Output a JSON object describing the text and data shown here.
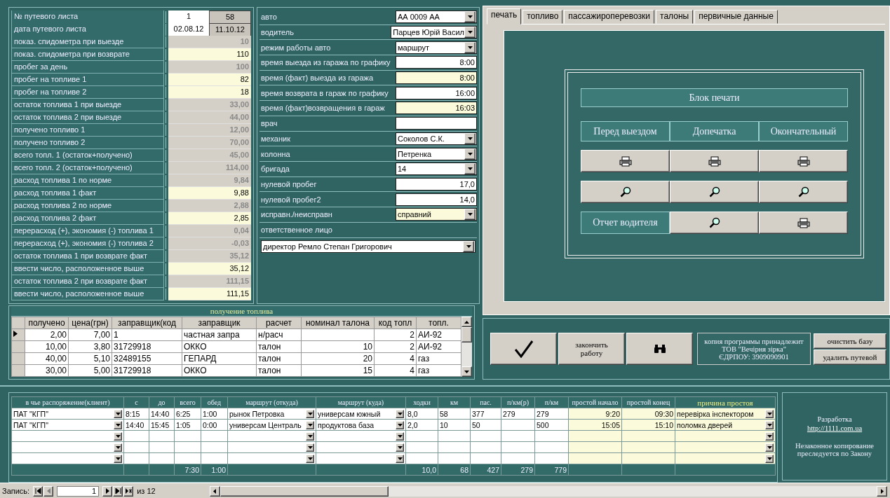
{
  "trip_sheet_fields": [
    {
      "label": "№ путевого листа",
      "values": [
        {
          "text": "1",
          "kind": "plain"
        },
        {
          "text": "58",
          "kind": "locked"
        }
      ]
    },
    {
      "label": "дата путевого листа",
      "values": [
        {
          "text": "02.08.12",
          "kind": "plain"
        },
        {
          "text": "11.10.12",
          "kind": "locked"
        }
      ]
    },
    {
      "label": "показ. спидометра при выезде",
      "values": [
        {
          "text": "10",
          "kind": "computed"
        }
      ]
    },
    {
      "label": "показ. спидометра при возврате",
      "values": [
        {
          "text": "110",
          "kind": "input"
        }
      ]
    },
    {
      "label": "пробег за день",
      "values": [
        {
          "text": "100",
          "kind": "computed"
        }
      ]
    },
    {
      "label": "пробег на топливе 1",
      "values": [
        {
          "text": "82",
          "kind": "input"
        }
      ]
    },
    {
      "label": "пробег на топливе 2",
      "values": [
        {
          "text": "18",
          "kind": "input"
        }
      ]
    },
    {
      "label": "остаток  топлива 1 при выезде",
      "values": [
        {
          "text": "33,00",
          "kind": "computed"
        }
      ]
    },
    {
      "label": "остаток топлива 2 при выезде",
      "values": [
        {
          "text": "44,00",
          "kind": "computed"
        }
      ]
    },
    {
      "label": "получено топливо 1",
      "values": [
        {
          "text": "12,00",
          "kind": "computed"
        }
      ]
    },
    {
      "label": "получено топливо 2",
      "values": [
        {
          "text": "70,00",
          "kind": "computed"
        }
      ]
    },
    {
      "label": "всего топл. 1 (остаток+получено)",
      "values": [
        {
          "text": "45,00",
          "kind": "computed"
        }
      ]
    },
    {
      "label": "всего топл. 2 (остаток+получено)",
      "values": [
        {
          "text": "114,00",
          "kind": "computed"
        }
      ]
    },
    {
      "label": "расход топлива 1 по норме",
      "values": [
        {
          "text": "9,84",
          "kind": "computed"
        }
      ]
    },
    {
      "label": "расход топлива 1 факт",
      "values": [
        {
          "text": "9,88",
          "kind": "input"
        }
      ]
    },
    {
      "label": "расход топлива 2 по норме",
      "values": [
        {
          "text": "2,88",
          "kind": "computed"
        }
      ]
    },
    {
      "label": "расход топлива 2 факт",
      "values": [
        {
          "text": "2,85",
          "kind": "input"
        }
      ]
    },
    {
      "label": "перерасход (+), экономия (-) топлива 1",
      "values": [
        {
          "text": "0,04",
          "kind": "computed"
        }
      ]
    },
    {
      "label": "перерасход (+), экономия (-) топлива 2",
      "values": [
        {
          "text": "-0,03",
          "kind": "computed"
        }
      ]
    },
    {
      "label": "остаток топлива 1 при возврате факт",
      "values": [
        {
          "text": "35,12",
          "kind": "computed"
        }
      ]
    },
    {
      "label": "ввести число, расположенное выше",
      "values": [
        {
          "text": "35,12",
          "kind": "input"
        }
      ]
    },
    {
      "label": "остаток топлива 2 при возврате факт",
      "values": [
        {
          "text": "111,15",
          "kind": "computed"
        }
      ]
    },
    {
      "label": "ввести число, расположенное выше",
      "values": [
        {
          "text": "111,15",
          "kind": "input"
        }
      ]
    }
  ],
  "vehicle_fields": [
    {
      "label": "авто",
      "kind": "dropdown",
      "value": "АА 0009 АА",
      "highlighted": false
    },
    {
      "label": "водитель",
      "kind": "dropdown",
      "value": "Парцев Юрій Васил",
      "highlighted": false
    },
    {
      "label": "режим работы авто",
      "kind": "dropdown",
      "value": "маршрут",
      "highlighted": false
    },
    {
      "label": "время выезда из гаража по графику",
      "kind": "input",
      "value": "8:00",
      "highlighted": false
    },
    {
      "label": "время (факт) выезда из гаража",
      "kind": "input",
      "value": "8:00",
      "highlighted": true
    },
    {
      "label": "время возврата в гараж по графику",
      "kind": "input",
      "value": "16:00",
      "highlighted": false
    },
    {
      "label": "время (факт)возвращения в гараж",
      "kind": "input",
      "value": "16:03",
      "highlighted": true
    },
    {
      "label": "врач",
      "kind": "input",
      "highlighted": false
    },
    {
      "label": "механик",
      "kind": "dropdown",
      "value": "Соколов С.К.",
      "highlighted": false
    },
    {
      "label": "колонна",
      "kind": "dropdown",
      "value": "Петренка",
      "highlighted": false
    },
    {
      "label": "бригада",
      "kind": "dropdown",
      "value": "14",
      "highlighted": false
    },
    {
      "label": "нулевой пробег",
      "kind": "input",
      "value": "17,0",
      "highlighted": false
    },
    {
      "label": "нулевой пробег2",
      "kind": "input",
      "value": "14,0",
      "highlighted": false
    },
    {
      "label": "исправн./неисправн",
      "kind": "dropdown",
      "value": "справний",
      "highlighted": true
    }
  ],
  "responsible": {
    "label": "ответственное лицо",
    "value": "директор Ремло Степан Григорович"
  },
  "tabs": [
    {
      "label": "печать",
      "selected": true
    },
    {
      "label": "топливо",
      "selected": false
    },
    {
      "label": "пассажироперевозки",
      "selected": false
    },
    {
      "label": "талоны",
      "selected": false
    },
    {
      "label": "первичные данные",
      "selected": false
    }
  ],
  "print_block": {
    "title": "Блок печати",
    "columns": [
      "Перед выездом",
      "Допечатка",
      "Окончательный"
    ],
    "rows": [
      {
        "buttons": [
          {
            "kind": "print"
          },
          {
            "kind": "print"
          },
          {
            "kind": "print"
          }
        ]
      },
      {
        "buttons": [
          {
            "kind": "preview"
          },
          {
            "kind": "preview"
          },
          {
            "kind": "preview"
          }
        ]
      },
      {
        "label": "Отчет водителя",
        "buttons": [
          {
            "kind": "preview"
          },
          {
            "kind": "print"
          }
        ]
      }
    ]
  },
  "fuel_table": {
    "title": "получение топлива",
    "columns": [
      {
        "label": "получено",
        "kind": "number"
      },
      {
        "label": "цена(грн)",
        "kind": "number"
      },
      {
        "label": "заправщик(код",
        "kind": "text"
      },
      {
        "label": "заправщик",
        "kind": "text"
      },
      {
        "label": "расчет",
        "kind": "text"
      },
      {
        "label": "номинал талона",
        "kind": "number"
      },
      {
        "label": "код топл",
        "kind": "number"
      },
      {
        "label": "топл.",
        "kind": "text"
      }
    ],
    "rows": [
      {
        "selected": true,
        "cells": [
          "2,00",
          "7,00",
          "1",
          "частная запра",
          "н/расч",
          null,
          "2",
          "АИ-92"
        ]
      },
      {
        "selected": false,
        "cells": [
          "10,00",
          "3,80",
          "31729918",
          "ОККО",
          "талон",
          "10",
          "2",
          "АИ-92"
        ]
      },
      {
        "selected": false,
        "cells": [
          "40,00",
          "5,10",
          "32489155",
          "ГЕПАРД",
          "талон",
          "20",
          "4",
          "газ"
        ]
      },
      {
        "selected": false,
        "cells": [
          "30,00",
          "5,00",
          "31729918",
          "ОККО",
          "талон",
          "15",
          "4",
          "газ"
        ]
      }
    ]
  },
  "actions": {
    "buttons": [
      {
        "kind": "confirm"
      },
      {
        "kind": "text",
        "label": "закончить работу"
      },
      {
        "kind": "find"
      }
    ],
    "owner_note": [
      "копия программы принадлежит",
      "ТОВ \"Вечірня зірка\"",
      "ЄДРПОУ: 3909090901"
    ],
    "side_buttons": [
      "очистить базу",
      "удалить путевой"
    ]
  },
  "trips": {
    "columns": [
      {
        "label": "в чье распоряжение(клиент)",
        "kind": "dropdown"
      },
      {
        "label": "с",
        "kind": "number"
      },
      {
        "label": "до",
        "kind": "number"
      },
      {
        "label": "всего",
        "kind": "number",
        "total": "7:30"
      },
      {
        "label": "обед",
        "kind": "number",
        "total": "1:00"
      },
      {
        "label": "маршрут (откуда)",
        "kind": "dropdown"
      },
      {
        "label": "маршрут (куда)",
        "kind": "dropdown"
      },
      {
        "label": "ходки",
        "kind": "number",
        "total": "10,0"
      },
      {
        "label": "км",
        "kind": "number",
        "total": "68"
      },
      {
        "label": "пас.",
        "kind": "number",
        "total": "427"
      },
      {
        "label": "п/км(р)",
        "kind": "number",
        "total": "279"
      },
      {
        "label": "п/км",
        "kind": "number",
        "total": "779"
      },
      {
        "label": "простой начало",
        "kind": "idle"
      },
      {
        "label": "простой конец",
        "kind": "idle"
      },
      {
        "label": "причина простоя",
        "kind": "idle_dropdown"
      }
    ],
    "rows": [
      [
        "ПАТ \"КГП\"",
        "8:15",
        "14:40",
        "6:25",
        "1:00",
        "рынок Петровка",
        "универсам южный",
        "8,0",
        "58",
        "377",
        "279",
        "279",
        "9:20",
        "09:30",
        "перевірка інспектором"
      ],
      [
        "ПАТ \"КГП\"",
        "14:40",
        "15:45",
        "1:05",
        "0:00",
        "универсам Централь",
        "продуктова база",
        "2,0",
        "10",
        "50",
        null,
        "500",
        "15:05",
        "15:10",
        "поломка дверей"
      ]
    ]
  },
  "developer": {
    "heading": "Разработка",
    "link": "http://1111.com.ua",
    "notice": "Незаконное копирование преследуется по Закону"
  },
  "record_nav": {
    "label": "Запись:",
    "current": "1",
    "total": "из 12"
  }
}
